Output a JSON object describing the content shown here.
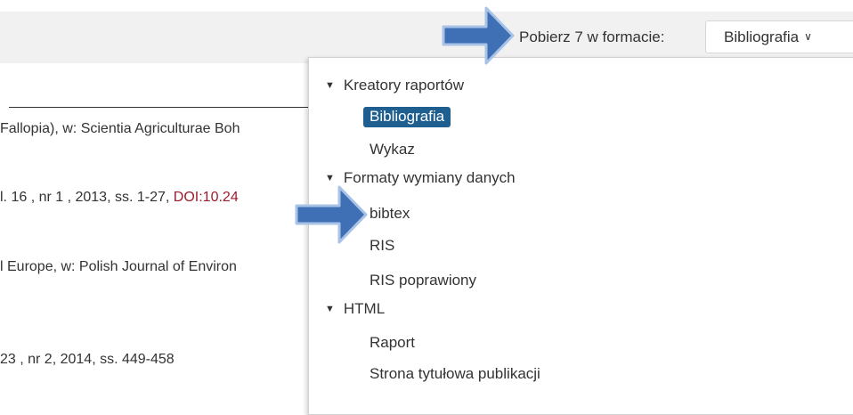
{
  "toolbar": {
    "export_label": "Pobierz 7 w formacie:",
    "format_value": "Bibliografia"
  },
  "results": [
    {
      "text": "Fallopia), w: Scientia Agriculturae Boh"
    },
    {
      "text": "l. 16 , nr 1 , 2013, ss. 1-27, ",
      "doi": "DOI:10.24"
    },
    {
      "text": "l Europe, w: Polish Journal of Environ"
    },
    {
      "text": "23 , nr 2, 2014, ss. 449-458"
    }
  ],
  "dropdown": {
    "groups": [
      {
        "label": "Kreatory raportów",
        "items": [
          "Bibliografia",
          "Wykaz"
        ]
      },
      {
        "label": "Formaty wymiany danych",
        "items": [
          "bibtex",
          "RIS",
          "RIS poprawiony"
        ]
      },
      {
        "label": "HTML",
        "items": [
          "Raport",
          "Strona tytułowa publikacji"
        ]
      }
    ],
    "selected": "Bibliografia"
  },
  "colors": {
    "selected_bg": "#1f5f8f",
    "doi_link": "#9b1c2c",
    "arrow_fill": "#3f6fb5"
  },
  "icons": {
    "select_chevron": "chevron-down-icon",
    "group_toggle": "triangle-down-icon",
    "annotation": "arrow-right-icon"
  }
}
